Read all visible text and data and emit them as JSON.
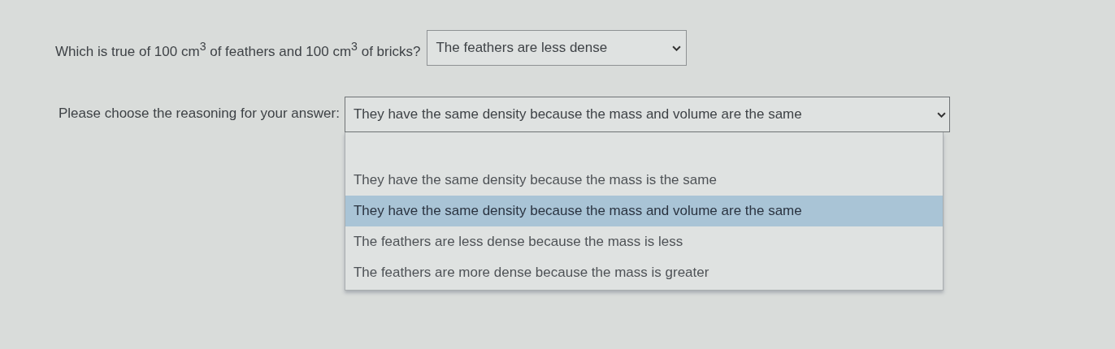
{
  "question": {
    "text": "Which is true of 100 cm$^{3}$ of feathers and 100 cm$^{3}$ of bricks?",
    "answer": "The feathers are less dense",
    "expanded": false
  },
  "reasoning": {
    "label": "Please choose the reasoning for your answer:",
    "answer": "They have the same density because the mass and volume are the same",
    "expanded": true,
    "options": [
      {
        "label": "They have the same density because the mass is the same",
        "selected": false
      },
      {
        "label": "They have the same density because the mass and volume are the same",
        "selected": true
      },
      {
        "label": "The feathers are less dense because the mass is less",
        "selected": false
      },
      {
        "label": "The feathers are more dense because the mass is greater",
        "selected": false
      }
    ]
  }
}
